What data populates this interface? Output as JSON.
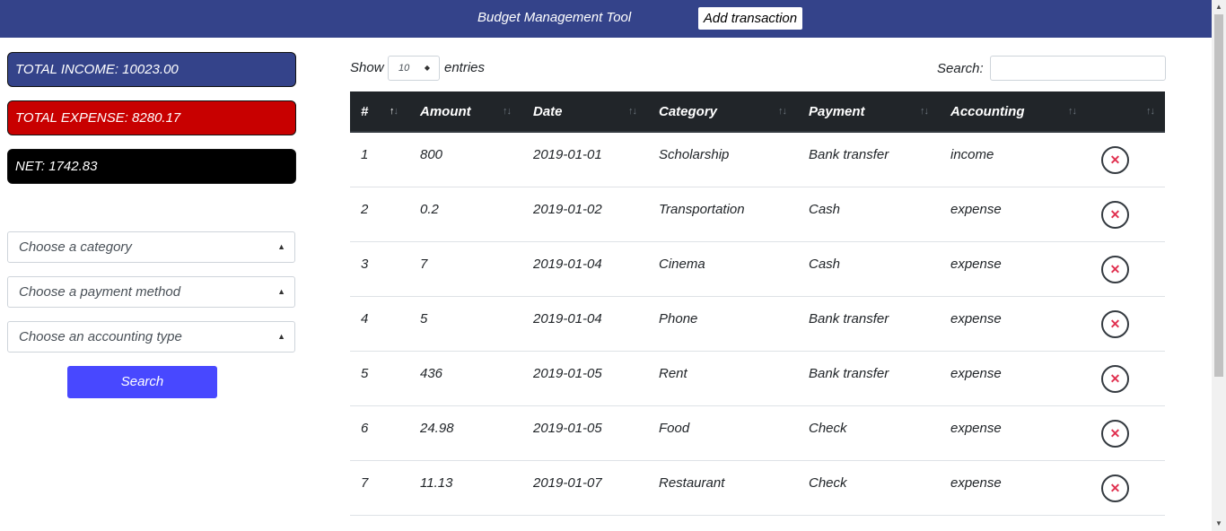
{
  "header": {
    "title": "Budget Management Tool",
    "add_button": "Add transaction",
    "background": "#34438a"
  },
  "summary": {
    "income": "TOTAL INCOME: 10023.00",
    "expense": "TOTAL EXPENSE: 8280.17",
    "net": "NET: 1742.83"
  },
  "filters": {
    "category": "Choose a category",
    "payment": "Choose a payment method",
    "accounting": "Choose an accounting type",
    "search_button": "Search"
  },
  "table_controls": {
    "show": "Show",
    "page_length": "10",
    "entries": "entries",
    "search_label": "Search:"
  },
  "columns": [
    "#",
    "Amount",
    "Date",
    "Category",
    "Payment",
    "Accounting"
  ],
  "rows": [
    {
      "num": "1",
      "amount": "800",
      "date": "2019-01-01",
      "category": "Scholarship",
      "payment": "Bank transfer",
      "accounting": "income"
    },
    {
      "num": "2",
      "amount": "0.2",
      "date": "2019-01-02",
      "category": "Transportation",
      "payment": "Cash",
      "accounting": "expense"
    },
    {
      "num": "3",
      "amount": "7",
      "date": "2019-01-04",
      "category": "Cinema",
      "payment": "Cash",
      "accounting": "expense"
    },
    {
      "num": "4",
      "amount": "5",
      "date": "2019-01-04",
      "category": "Phone",
      "payment": "Bank transfer",
      "accounting": "expense"
    },
    {
      "num": "5",
      "amount": "436",
      "date": "2019-01-05",
      "category": "Rent",
      "payment": "Bank transfer",
      "accounting": "expense"
    },
    {
      "num": "6",
      "amount": "24.98",
      "date": "2019-01-05",
      "category": "Food",
      "payment": "Check",
      "accounting": "expense"
    },
    {
      "num": "7",
      "amount": "11.13",
      "date": "2019-01-07",
      "category": "Restaurant",
      "payment": "Check",
      "accounting": "expense"
    }
  ],
  "icons": {
    "delete": "close-circle-icon",
    "sort": "sort-arrows-icon",
    "select_caret": "chevron-updown-icon"
  }
}
